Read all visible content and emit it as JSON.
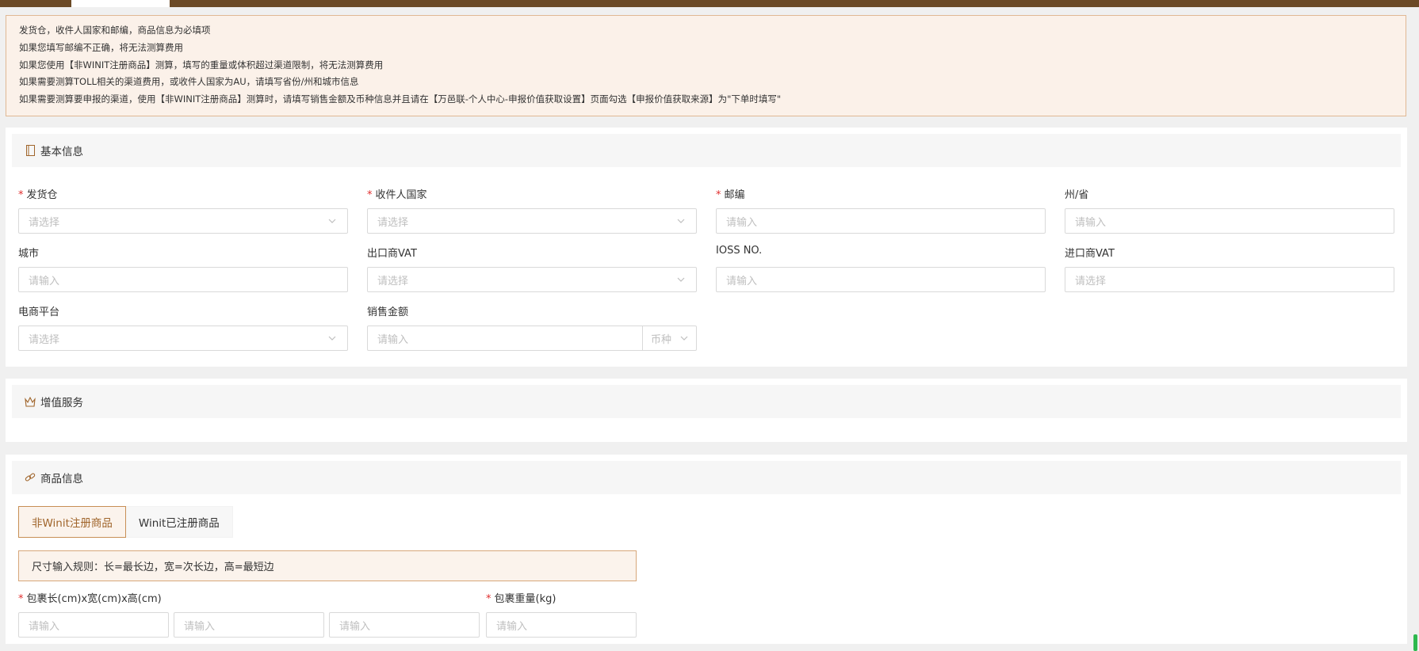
{
  "notice": {
    "lines": [
      "发货仓，收件人国家和邮编，商品信息为必填项",
      "如果您填写邮编不正确，将无法测算费用",
      "如果您使用【非WINIT注册商品】测算，填写的重量或体积超过渠道限制，将无法测算费用",
      "如果需要测算TOLL相关的渠道费用，或收件人国家为AU，请填写省份/州和城市信息",
      "如果需要测算要申报的渠道，使用【非WINIT注册商品】测算时，请填写销售金额及币种信息并且请在【万邑联-个人中心-申报价值获取设置】页面勾选【申报价值获取来源】为\"下单时填写\""
    ]
  },
  "basic": {
    "title": "基本信息",
    "icon": "document-icon",
    "fields": {
      "warehouse": {
        "label": "发货仓",
        "placeholder": "请选择",
        "required": true
      },
      "country": {
        "label": "收件人国家",
        "placeholder": "请选择",
        "required": true
      },
      "zipcode": {
        "label": "邮编",
        "placeholder": "请输入",
        "required": true
      },
      "state": {
        "label": "州/省",
        "placeholder": "请输入"
      },
      "city": {
        "label": "城市",
        "placeholder": "请输入"
      },
      "exporter_vat": {
        "label": "出口商VAT",
        "placeholder": "请选择"
      },
      "ioss": {
        "label": "IOSS NO.",
        "placeholder": "请输入"
      },
      "importer_vat": {
        "label": "进口商VAT",
        "placeholder": "请选择"
      },
      "platform": {
        "label": "电商平台",
        "placeholder": "请选择"
      },
      "sales_amount": {
        "label": "销售金额",
        "placeholder": "请输入",
        "currency_placeholder": "币种"
      }
    }
  },
  "value_added": {
    "title": "增值服务",
    "icon": "crown-icon"
  },
  "goods": {
    "title": "商品信息",
    "icon": "link-icon",
    "tabs": [
      "非Winit注册商品",
      "Winit已注册商品"
    ],
    "active_tab": 0,
    "rule": "尺寸输入规则：长=最长边，宽=次长边，高=最短边",
    "dimensions": {
      "label": "包裹长(cm)x宽(cm)x高(cm)",
      "placeholder": "请输入",
      "required": true
    },
    "weight": {
      "label": "包裹重量(kg)",
      "placeholder": "请输入",
      "required": true
    }
  },
  "colors": {
    "accent": "#a0652b",
    "topbar": "#6b4a26",
    "required": "#e02e2e",
    "scrollbar": "#2db84d"
  }
}
